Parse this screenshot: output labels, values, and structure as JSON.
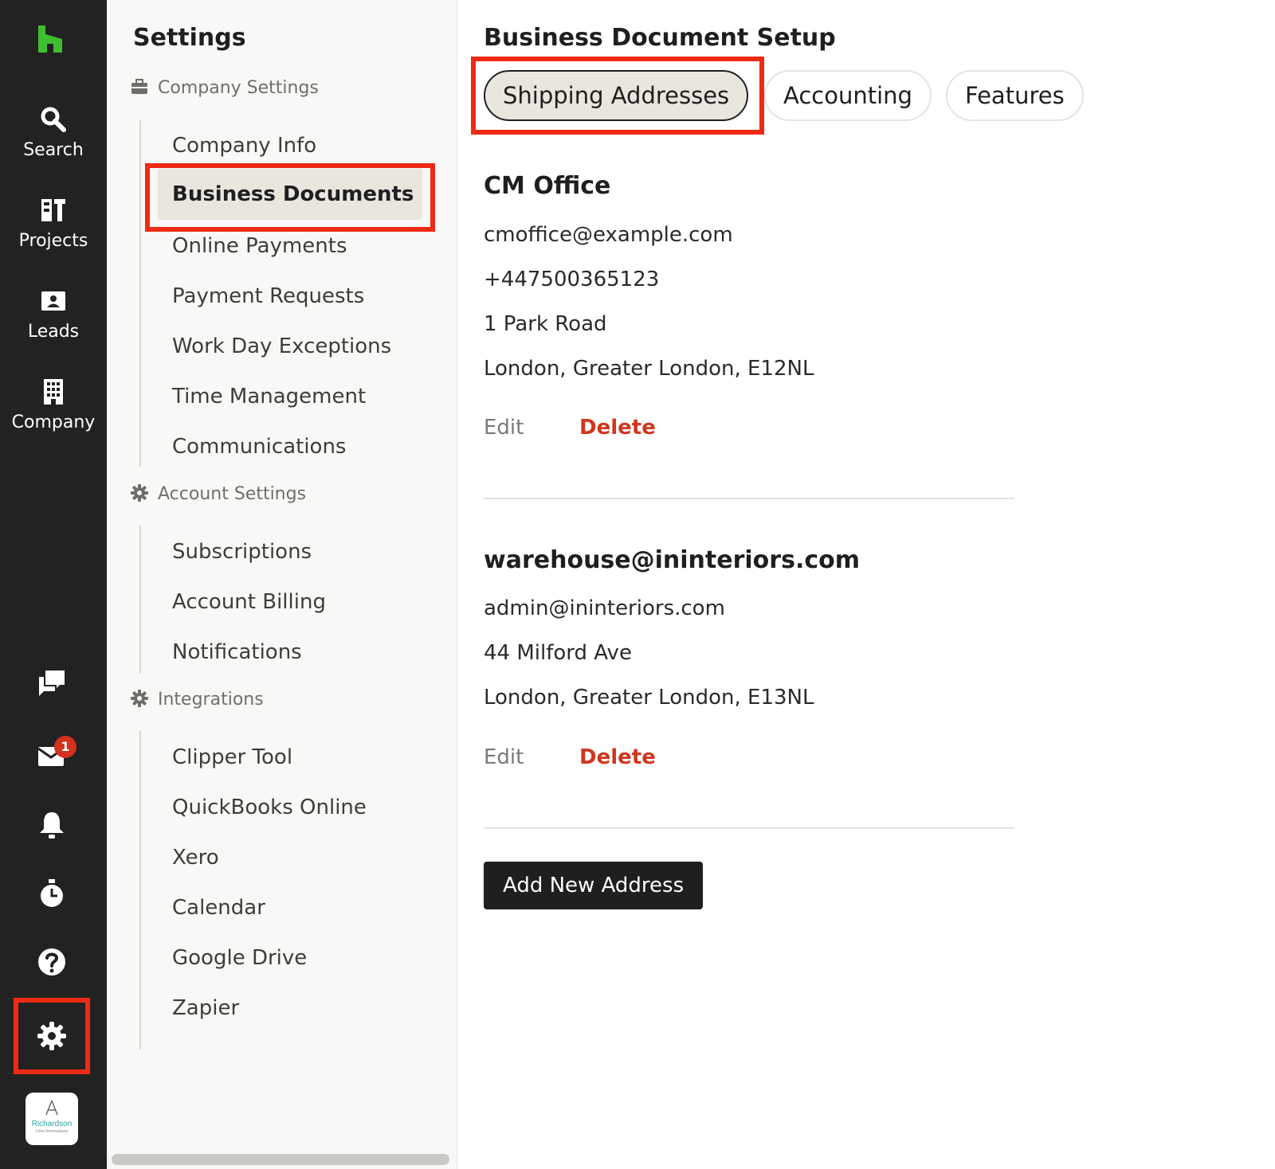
{
  "colors": {
    "rail_bg": "#222222",
    "brand_green": "#3fbf2f",
    "highlight_red": "#ee2a14",
    "delete_red": "#d0361e",
    "active_bg": "#e9e6de"
  },
  "rail": {
    "logo_icon": "houzz-logo-icon",
    "nav": [
      {
        "label": "Search",
        "icon": "search-icon"
      },
      {
        "label": "Projects",
        "icon": "projects-icon"
      },
      {
        "label": "Leads",
        "icon": "leads-icon"
      },
      {
        "label": "Company",
        "icon": "company-building-icon"
      }
    ],
    "bottom_icons": [
      "chat-icon",
      "mail-icon",
      "bell-icon",
      "timer-icon",
      "help-icon",
      "gear-icon"
    ],
    "mail_badge": "1",
    "avatar": {
      "text": "Richardson",
      "subtext": "Lime Renovations"
    }
  },
  "sidebar": {
    "title": "Settings",
    "sections": [
      {
        "label": "Company Settings",
        "icon": "briefcase-icon",
        "items": [
          "Company Info",
          "Business Documents",
          "Online Payments",
          "Payment Requests",
          "Work Day Exceptions",
          "Time Management",
          "Communications"
        ]
      },
      {
        "label": "Account Settings",
        "icon": "gear-icon",
        "items": [
          "Subscriptions",
          "Account Billing",
          "Notifications"
        ]
      },
      {
        "label": "Integrations",
        "icon": "gear-icon",
        "items": [
          "Clipper Tool",
          "QuickBooks Online",
          "Xero",
          "Calendar",
          "Google Drive",
          "Zapier"
        ]
      }
    ],
    "active_item": "Business Documents"
  },
  "main": {
    "title": "Business Document Setup",
    "tabs": [
      "Shipping Addresses",
      "Accounting",
      "Features"
    ],
    "active_tab": "Shipping Addresses",
    "addresses": [
      {
        "name": "CM Office",
        "lines": [
          "cmoffice@example.com",
          "+447500365123",
          "1 Park Road",
          "London, Greater London, E12NL"
        ],
        "edit_label": "Edit",
        "delete_label": "Delete"
      },
      {
        "name": "warehouse@ininteriors.com",
        "lines": [
          "admin@ininteriors.com",
          "44 Milford Ave",
          "London, Greater London, E13NL"
        ],
        "edit_label": "Edit",
        "delete_label": "Delete"
      }
    ],
    "add_button": "Add New Address"
  }
}
